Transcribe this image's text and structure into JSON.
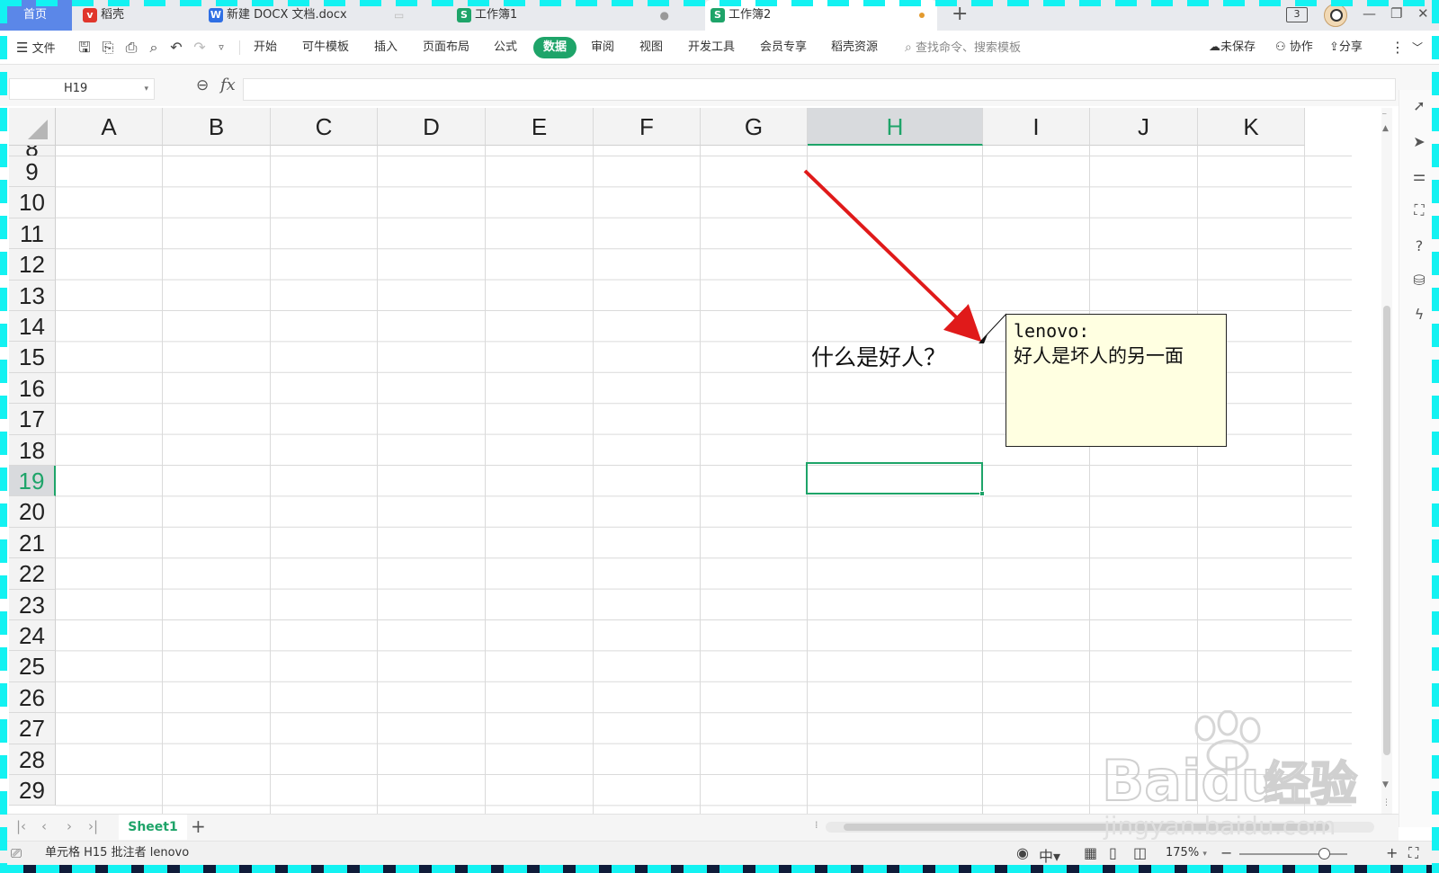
{
  "tabs": {
    "home": "首页",
    "daoke": "稻壳",
    "docx": "新建 DOCX 文档.docx",
    "book1": "工作簿1",
    "book2": "工作簿2",
    "add": "+",
    "badge": "3"
  },
  "ribbon": {
    "file": "文件",
    "items": [
      "开始",
      "可牛模板",
      "插入",
      "页面布局",
      "公式",
      "数据",
      "审阅",
      "视图",
      "开发工具",
      "会员专享",
      "稻壳资源"
    ],
    "search_placeholder": "查找命令、搜索模板",
    "unsaved": "未保存",
    "collab": "协作",
    "share": "分享"
  },
  "formula_bar": {
    "name_box": "H19",
    "fx": "fx",
    "value": ""
  },
  "grid": {
    "columns": [
      "A",
      "B",
      "C",
      "D",
      "E",
      "F",
      "G",
      "H",
      "I",
      "J",
      "K"
    ],
    "selected_column": "H",
    "rows": [
      "8",
      "9",
      "10",
      "11",
      "12",
      "13",
      "14",
      "15",
      "16",
      "17",
      "18",
      "19",
      "20",
      "21",
      "22",
      "23",
      "24",
      "25",
      "26",
      "27",
      "28",
      "29"
    ],
    "selected_row": "19",
    "cells": {
      "H15": "什么是好人？"
    }
  },
  "comment": {
    "author": "lenovo:",
    "body": "好人是坏人的另一面"
  },
  "sheets": {
    "active": "Sheet1",
    "add": "+"
  },
  "status": {
    "text": "单元格 H15 批注者 lenovo",
    "zoom": "175%"
  },
  "colors": {
    "accent": "#1ea469",
    "arrow": "#e01a1a",
    "comment_bg": "#ffffe1",
    "home_tab": "#5b87e8",
    "frame": "#13f2f2"
  },
  "watermark": {
    "brand": "Baidu",
    "brand_cn": "经验",
    "url": "jingyan.baidu.com"
  }
}
